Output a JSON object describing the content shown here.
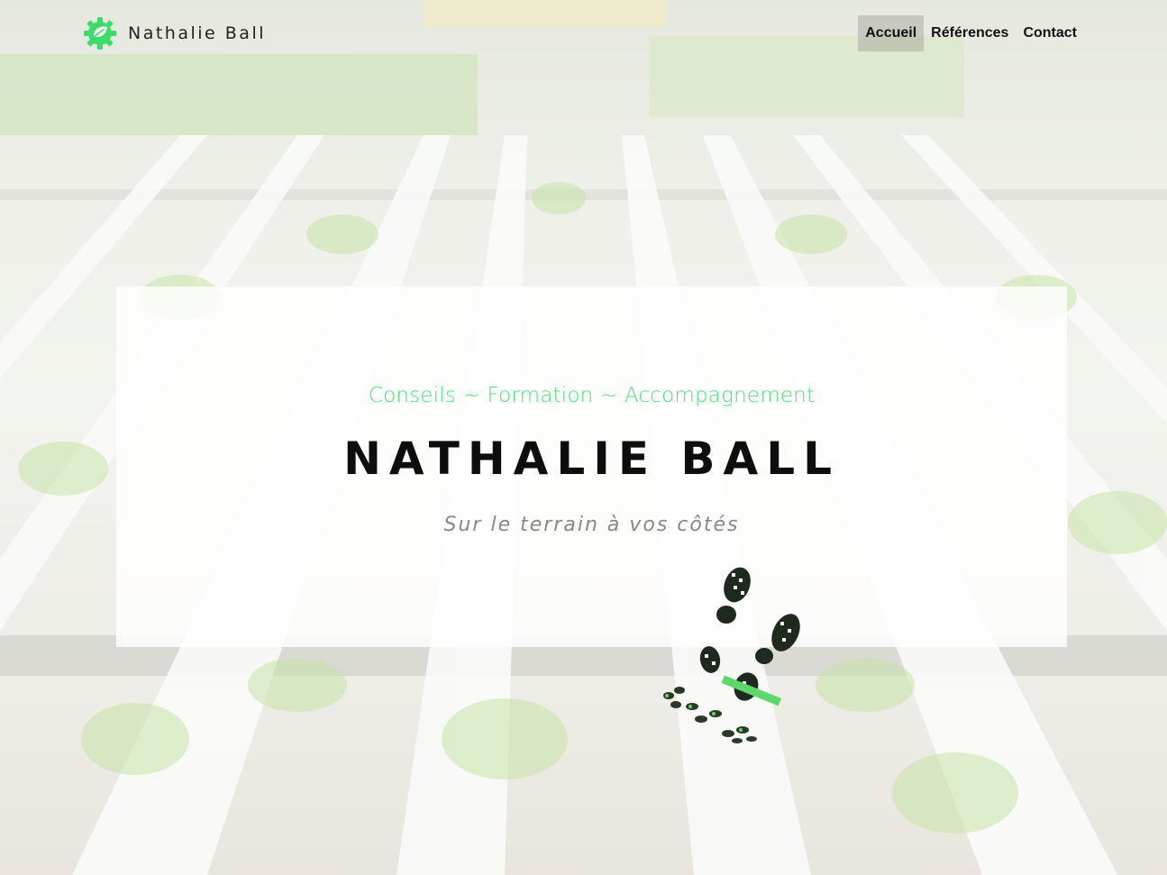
{
  "header": {
    "brand_name": "Nathalie Ball",
    "logo_icon": "gear-leaf-icon",
    "nav": [
      {
        "label": "Accueil",
        "active": true
      },
      {
        "label": "Références",
        "active": false
      },
      {
        "label": "Contact",
        "active": false
      }
    ]
  },
  "hero": {
    "tagline": "Conseils ~ Formation ~ Accompagnement",
    "title": "NATHALIE BALL",
    "subtitle": "Sur le terrain à vos côtés"
  },
  "illustration": {
    "icon": "footprints-icon"
  },
  "colors": {
    "accent": "#4fe07a",
    "title": "#0d0d0d",
    "subtitle": "#888888"
  }
}
